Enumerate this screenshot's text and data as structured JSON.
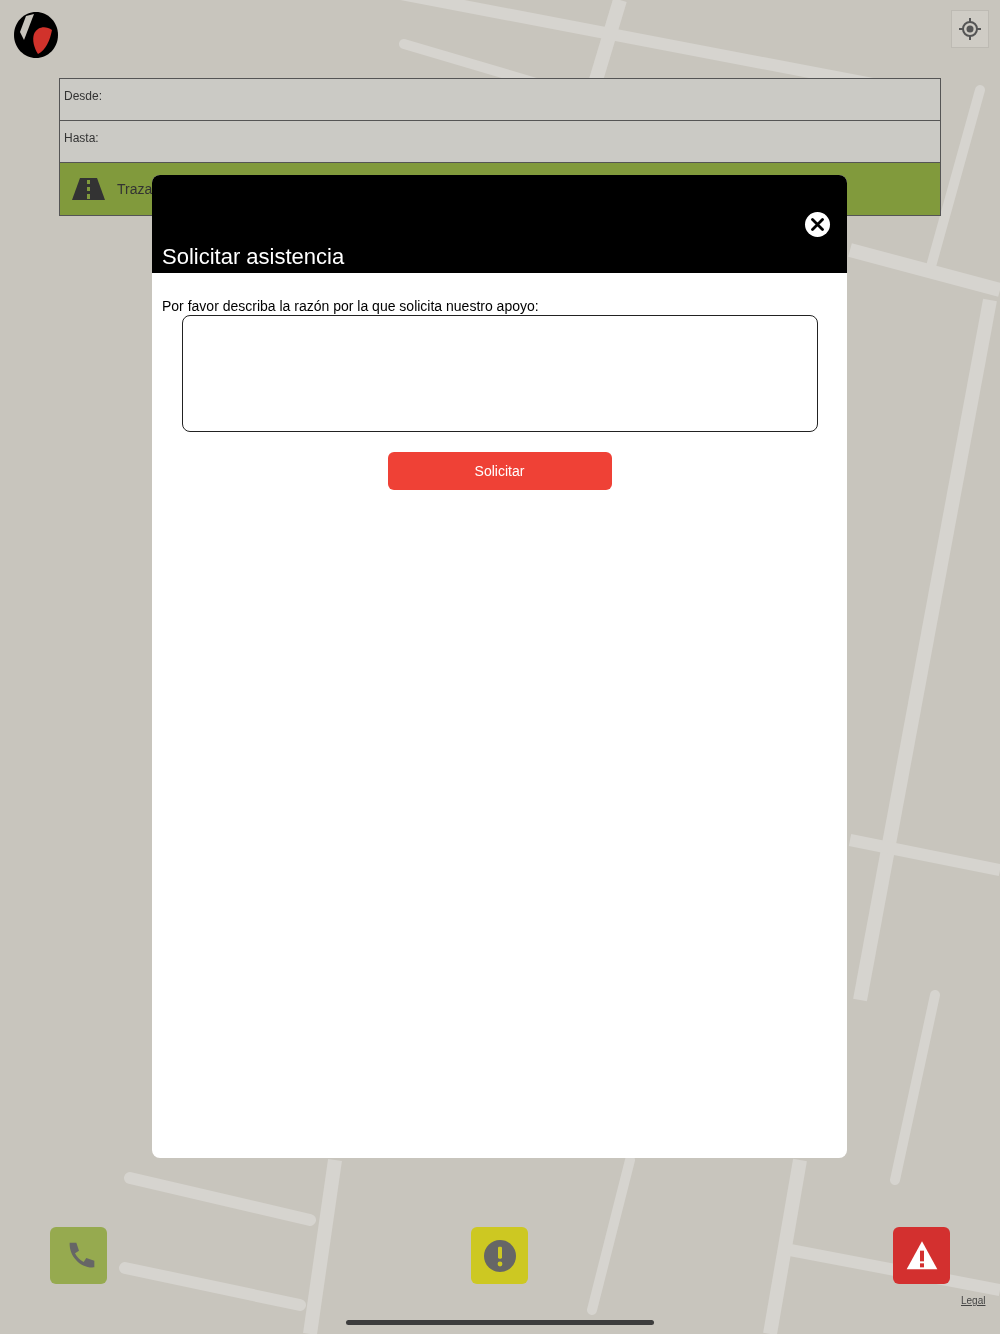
{
  "map": {
    "legal_link": "Legal"
  },
  "route_form": {
    "fields": [
      {
        "label": "Desde:"
      },
      {
        "label": "Hasta:"
      }
    ],
    "route_button": {
      "label": "Traza"
    }
  },
  "dialog": {
    "title": "Solicitar asistencia",
    "prompt": "Por favor describa la razón por la que solicita nuestro apoyo:",
    "submit_button": "Solicitar"
  },
  "action_buttons": [
    {
      "kind": "call",
      "color": "#96aa4f"
    },
    {
      "kind": "report",
      "color": "#cdc822"
    },
    {
      "kind": "alert",
      "color": "#d3302f"
    }
  ]
}
